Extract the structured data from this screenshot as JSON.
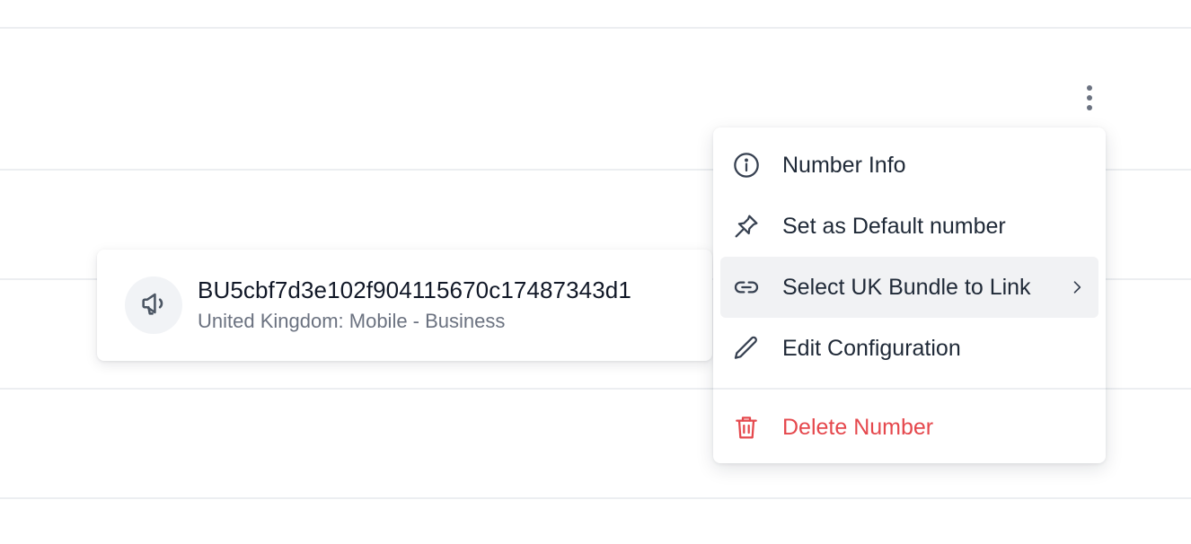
{
  "colors": {
    "text_primary": "#1f2937",
    "text_secondary": "#6b7280",
    "danger": "#e5484d",
    "menu_hover": "#f1f2f4",
    "divider": "#eceef1"
  },
  "bundle_card": {
    "icon": "megaphone-icon",
    "bundle_id": "BU5cbf7d3e102f904115670c17487343d1",
    "description": "United Kingdom: Mobile - Business"
  },
  "row_menu_button": {
    "icon": "more-vertical-icon"
  },
  "context_menu": {
    "items": [
      {
        "label": "Number Info",
        "icon": "info-circle-icon"
      },
      {
        "label": "Set as Default number",
        "icon": "pin-icon"
      },
      {
        "label": "Select UK Bundle to Link",
        "icon": "link-icon",
        "submenu_icon": "chevron-right-icon",
        "active": true
      },
      {
        "label": "Edit Configuration",
        "icon": "pencil-icon"
      }
    ],
    "danger_item": {
      "label": "Delete Number",
      "icon": "trash-icon"
    }
  }
}
